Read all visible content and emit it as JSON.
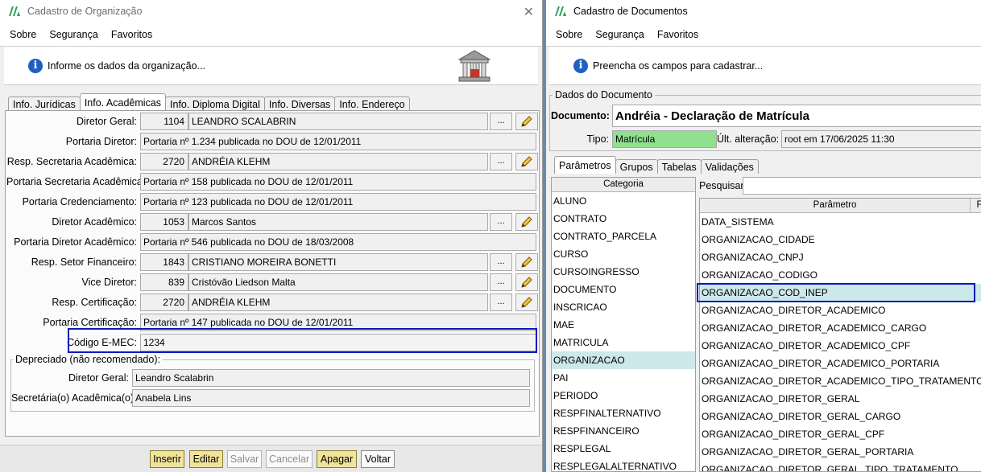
{
  "left": {
    "title": "Cadastro de Organização",
    "menu": [
      "Sobre",
      "Segurança",
      "Favoritos"
    ],
    "banner_text": "Informe os dados da organização...",
    "tabs": [
      "Info. Jurídicas",
      "Info. Acadêmicas",
      "Info. Diploma Digital",
      "Info. Diversas",
      "Info. Endereço"
    ],
    "fields": {
      "diretor_geral": {
        "label": "Diretor Geral:",
        "code": "1104",
        "name": "LEANDRO SCALABRIN"
      },
      "portaria_diretor": {
        "label": "Portaria Diretor:",
        "value": "Portaria nº 1.234 publicada no DOU de 12/01/2011"
      },
      "resp_secretaria": {
        "label": "Resp. Secretaria Acadêmica:",
        "code": "2720",
        "name": "ANDRÉIA KLEHM"
      },
      "portaria_secretaria": {
        "label": "Portaria Secretaria Acadêmica:",
        "value": "Portaria nº 158 publicada no DOU de 12/01/2011"
      },
      "portaria_credenciamento": {
        "label": "Portaria Credenciamento:",
        "value": "Portaria nº 123 publicada no DOU de 12/01/2011"
      },
      "diretor_academico": {
        "label": "Diretor Acadêmico:",
        "code": "1053",
        "name": "Marcos Santos"
      },
      "portaria_diretor_academico": {
        "label": "Portaria Diretor Acadêmico:",
        "value": "Portaria nº 546 publicada no DOU de 18/03/2008"
      },
      "resp_financeiro": {
        "label": "Resp. Setor Financeiro:",
        "code": "1843",
        "name": "CRISTIANO MOREIRA BONETTI"
      },
      "vice_diretor": {
        "label": "Vice Diretor:",
        "code": "839",
        "name": "Cristóvão Liedson Malta"
      },
      "resp_certificacao": {
        "label": "Resp. Certificação:",
        "code": "2720",
        "name": "ANDRÉIA KLEHM"
      },
      "portaria_certificacao": {
        "label": "Portaria Certificação:",
        "value": "Portaria nº 147 publicada no DOU de 12/01/2011"
      },
      "codigo_emec": {
        "label": "Código E-MEC:",
        "value": "1234"
      }
    },
    "depreciado": {
      "title": "Depreciado (não recomendado):",
      "diretor_geral_label": "Diretor Geral:",
      "diretor_geral": "Leandro Scalabrin",
      "secretaria_label": "Secretária(o) Acadêmica(o):",
      "secretaria": "Anabela Lins"
    },
    "buttons": [
      "Inserir",
      "Editar",
      "Salvar",
      "Cancelar",
      "Apagar",
      "Voltar"
    ],
    "dots": "..."
  },
  "right": {
    "title": "Cadastro de Documentos",
    "menu": [
      "Sobre",
      "Segurança",
      "Favoritos"
    ],
    "banner_text": "Preencha os campos para cadastrar...",
    "group_title": "Dados do Documento",
    "documento_label": "Documento:",
    "documento": "Andréia - Declaração de Matrícula",
    "tipo_label": "Tipo:",
    "tipo": "Matrícula",
    "ult_alteracao_label": "Últ. alteração:",
    "ult_alteracao": "root em 17/06/2025 11:30",
    "tabs": [
      "Parâmetros",
      "Grupos",
      "Tabelas",
      "Validações"
    ],
    "categoria_header": "Categoria",
    "categorias": [
      "ALUNO",
      "CONTRATO",
      "CONTRATO_PARCELA",
      "CURSO",
      "CURSOINGRESSO",
      "DOCUMENTO",
      "INSCRICAO",
      "MAE",
      "MATRICULA",
      "ORGANIZACAO",
      "PAI",
      "PERIODO",
      "RESPFINALTERNATIVO",
      "RESPFINANCEIRO",
      "RESPLEGAL",
      "RESPLEGALALTERNATIVO"
    ],
    "pesquisar_label": "Pesquisar:",
    "pesquisar_value": "",
    "parametro_header": "Parâmetro",
    "parametro_header2": "F",
    "parametros": [
      "DATA_SISTEMA",
      "ORGANIZACAO_CIDADE",
      "ORGANIZACAO_CNPJ",
      "ORGANIZACAO_CODIGO",
      "ORGANIZACAO_COD_INEP",
      "ORGANIZACAO_DIRETOR_ACADEMICO",
      "ORGANIZACAO_DIRETOR_ACADEMICO_CARGO",
      "ORGANIZACAO_DIRETOR_ACADEMICO_CPF",
      "ORGANIZACAO_DIRETOR_ACADEMICO_PORTARIA",
      "ORGANIZACAO_DIRETOR_ACADEMICO_TIPO_TRATAMENTO",
      "ORGANIZACAO_DIRETOR_GERAL",
      "ORGANIZACAO_DIRETOR_GERAL_CARGO",
      "ORGANIZACAO_DIRETOR_GERAL_CPF",
      "ORGANIZACAO_DIRETOR_GERAL_PORTARIA",
      "ORGANIZACAO_DIRETOR_GERAL_TIPO_TRATAMENTO"
    ]
  },
  "colors": {
    "highlight": "#0a1bb8",
    "tipo_bg": "#8fe08f",
    "selected_row": "#cde8ea",
    "button_yellow": "#f0e39b"
  }
}
